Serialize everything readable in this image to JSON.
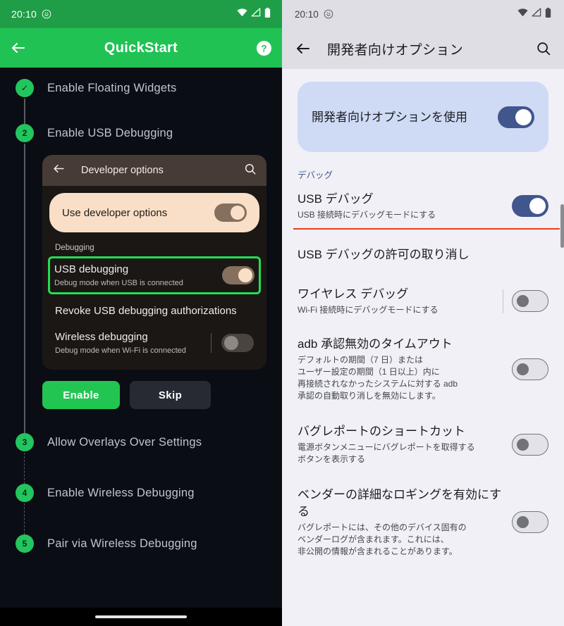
{
  "left_panel": {
    "status_bar": {
      "time": "20:10",
      "icons": [
        "notification-icon",
        "wifi-icon",
        "cellular-icon",
        "battery-icon"
      ]
    },
    "app_bar": {
      "title": "QuickStart",
      "back_icon": "back-arrow-icon",
      "help_icon": "help-circle-icon"
    },
    "steps": [
      {
        "marker": "✓",
        "label": "Enable Floating Widgets",
        "state": "done"
      },
      {
        "marker": "2",
        "label": "Enable USB Debugging",
        "state": "active"
      },
      {
        "marker": "3",
        "label": "Allow Overlays Over Settings",
        "state": "pending"
      },
      {
        "marker": "4",
        "label": "Enable Wireless Debugging",
        "state": "pending"
      },
      {
        "marker": "5",
        "label": "Pair via Wireless Debugging",
        "state": "pending"
      }
    ],
    "mock": {
      "app_bar_title": "Developer options",
      "back_icon": "back-arrow-icon",
      "search_icon": "search-icon",
      "use_developer_options": {
        "label": "Use developer options",
        "toggle": "on"
      },
      "section_caption": "Debugging",
      "rows": [
        {
          "title": "USB debugging",
          "sub": "Debug mode when USB is connected",
          "toggle": "on",
          "highlighted": true
        },
        {
          "title": "Revoke USB debugging authorizations",
          "sub": "",
          "toggle": "none",
          "highlighted": false
        },
        {
          "title": "Wireless debugging",
          "sub": "Debug mode when Wi-Fi is connected",
          "toggle": "off",
          "highlighted": false
        }
      ]
    },
    "actions": {
      "primary": "Enable",
      "secondary": "Skip"
    },
    "colors": {
      "accent_green": "#22c552",
      "header_green": "#21c254",
      "highlight_green": "#22dd55",
      "background": "#0b0d14"
    }
  },
  "right_panel": {
    "status_bar": {
      "time": "20:10",
      "icons": [
        "notification-icon",
        "wifi-icon",
        "cellular-icon",
        "battery-icon"
      ]
    },
    "app_bar": {
      "title": "開発者向けオプション",
      "back_icon": "back-arrow-icon",
      "search_icon": "search-icon"
    },
    "master_toggle": {
      "label": "開発者向けオプションを使用",
      "toggle": "on"
    },
    "section_caption": "デバッグ",
    "rows": [
      {
        "title": "USB デバッグ",
        "sub": "USB 接続時にデバッグモードにする",
        "toggle": "on",
        "underlined": true,
        "divider": false
      },
      {
        "title": "USB デバッグの許可の取り消し",
        "sub": "",
        "toggle": "none",
        "underlined": false,
        "divider": false
      },
      {
        "title": "ワイヤレス デバッグ",
        "sub": "Wi-Fi 接続時にデバッグモードにする",
        "toggle": "off",
        "underlined": false,
        "divider": true
      },
      {
        "title": "adb 承認無効のタイムアウト",
        "sub": "デフォルトの期間（7 日）または\nユーザー設定の期間（1 日以上）内に\n再接続されなかったシステムに対する adb\n承認の自動取り消しを無効にします。",
        "toggle": "off",
        "underlined": false,
        "divider": false
      },
      {
        "title": "バグレポートのショートカット",
        "sub": "電源ボタンメニューにバグレポートを取得する\nボタンを表示する",
        "toggle": "off",
        "underlined": false,
        "divider": false
      },
      {
        "title": "ベンダーの詳細なロギングを有効にする",
        "sub": "バグレポートには、その他のデバイス固有の\nベンダーログが含まれます。これには、\n非公開の情報が含まれることがあります。",
        "toggle": "off",
        "underlined": false,
        "divider": false
      }
    ],
    "colors": {
      "accent_blue": "#41568c",
      "card_blue": "#cfdbf5",
      "underline_red": "#ee3b1c",
      "background": "#f1f0f7"
    }
  }
}
